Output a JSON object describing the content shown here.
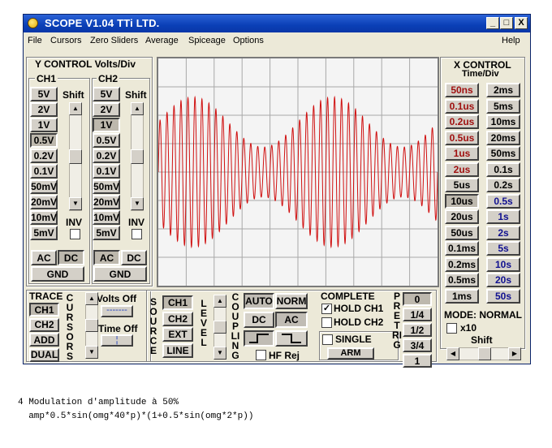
{
  "window": {
    "title": "SCOPE V1.04 TTi LTD.",
    "min": "_",
    "max": "□",
    "close": "X"
  },
  "menu": [
    "File",
    "Cursors",
    "Zero Sliders",
    "Average",
    "Spiceage",
    "Options",
    "Help"
  ],
  "y_control": {
    "title": "Y CONTROL Volts/Div",
    "ch1_label": "CH1",
    "ch2_label": "CH2",
    "shift_label": "Shift",
    "inv_label": "INV",
    "volts": [
      "5V",
      "2V",
      "1V",
      "0.5V",
      "0.2V",
      "0.1V",
      "50mV",
      "20mV",
      "10mV",
      "5mV"
    ],
    "ch1_selected": "0.5V",
    "ch2_selected": "1V",
    "ac": "AC",
    "dc": "DC",
    "gnd": "GND"
  },
  "x_control": {
    "title": "X CONTROL",
    "subtitle": "Time/Div",
    "col1": [
      "50ns",
      "0.1us",
      "0.2us",
      "0.5us",
      "1us",
      "2us",
      "5us",
      "10us",
      "20us",
      "50us",
      "0.1ms",
      "0.2ms",
      "0.5ms",
      "1ms"
    ],
    "col2": [
      "2ms",
      "5ms",
      "10ms",
      "20ms",
      "50ms",
      "0.1s",
      "0.2s",
      "0.5s",
      "1s",
      "2s",
      "5s",
      "10s",
      "20s",
      "50s"
    ],
    "selected": "10us",
    "mode": "MODE: NORMAL",
    "x10": "x10",
    "shift": "Shift"
  },
  "trace": {
    "title": "TRACE",
    "buttons": [
      "CH1",
      "CH2",
      "ADD",
      "DUAL"
    ],
    "selected": "CH1"
  },
  "cursors": {
    "vertical": "CURSORS",
    "volts_off": "Volts Off",
    "time_off": "Time Off"
  },
  "source": {
    "vertical": "SOURCE",
    "buttons": [
      "CH1",
      "CH2",
      "EXT",
      "LINE"
    ],
    "selected": "CH1"
  },
  "level": {
    "vertical": "LEVEL"
  },
  "coupling": {
    "vertical": "COUPLING",
    "auto": "AUTO",
    "norm": "NORM",
    "dc": "DC",
    "ac": "AC",
    "hf_rej": "HF Rej"
  },
  "complete": {
    "title": "COMPLETE",
    "hold_ch1": "HOLD CH1",
    "hold_ch2": "HOLD CH2",
    "single": "SINGLE",
    "arm": "ARM",
    "hold_ch1_checked": "✓"
  },
  "pretrig": {
    "vertical": "PRETRIG",
    "options": [
      "0",
      "1/4",
      "1/2",
      "3/4",
      "1"
    ],
    "selected": "0"
  },
  "waveform": {
    "color": "#d01010",
    "carrier_cycles": 40,
    "modulation_cycles": 2,
    "modulation_index": 0.5,
    "amplitude_fraction": 0.66
  },
  "caption": {
    "line1": "4 Modulation d'amplitude à 50%",
    "line2": "  amp*0.5*sin(omg*40*p)*(1+0.5*sin(omg*2*p))"
  }
}
